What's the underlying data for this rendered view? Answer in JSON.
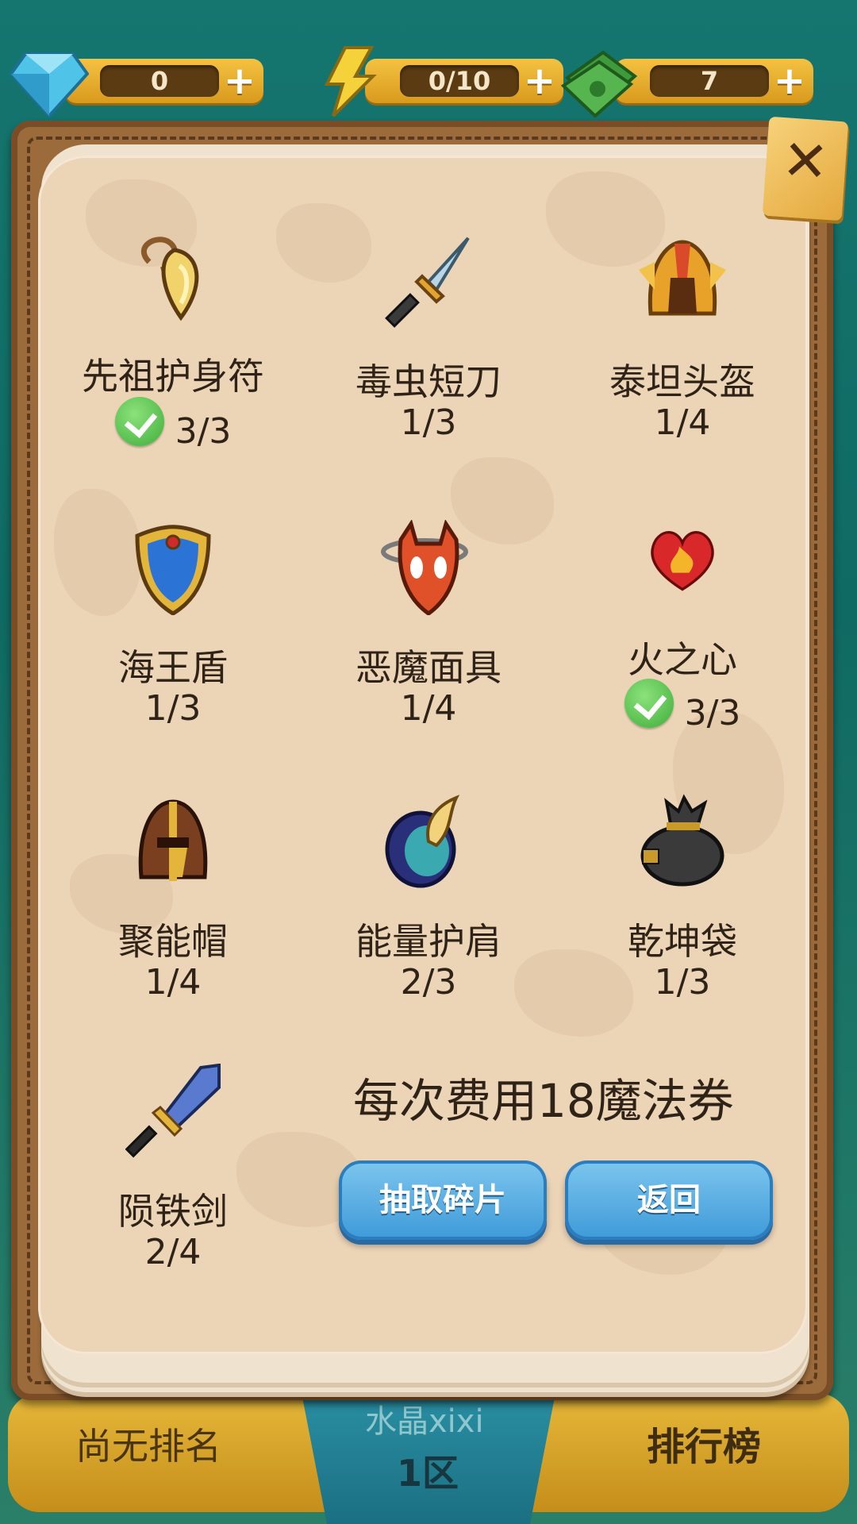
{
  "resources": [
    {
      "name": "diamond",
      "icon": "diamond-icon",
      "value": "0"
    },
    {
      "name": "energy",
      "icon": "lightning-icon",
      "value": "0/10"
    },
    {
      "name": "cash",
      "icon": "cash-icon",
      "value": "7"
    }
  ],
  "items": [
    {
      "name": "先祖护身符",
      "count": "3/3",
      "complete": true,
      "icon": "amulet-icon"
    },
    {
      "name": "毒虫短刀",
      "count": "1/3",
      "complete": false,
      "icon": "dagger-icon"
    },
    {
      "name": "泰坦头盔",
      "count": "1/4",
      "complete": false,
      "icon": "titan-helmet-icon"
    },
    {
      "name": "海王盾",
      "count": "1/3",
      "complete": false,
      "icon": "shield-icon"
    },
    {
      "name": "恶魔面具",
      "count": "1/4",
      "complete": false,
      "icon": "demon-mask-icon"
    },
    {
      "name": "火之心",
      "count": "3/3",
      "complete": true,
      "icon": "fire-heart-icon"
    },
    {
      "name": "聚能帽",
      "count": "1/4",
      "complete": false,
      "icon": "bronze-helmet-icon"
    },
    {
      "name": "能量护肩",
      "count": "2/3",
      "complete": false,
      "icon": "shoulder-pad-icon"
    },
    {
      "name": "乾坤袋",
      "count": "1/3",
      "complete": false,
      "icon": "bag-icon"
    },
    {
      "name": "陨铁剑",
      "count": "2/4",
      "complete": false,
      "icon": "meteor-sword-icon"
    }
  ],
  "cost_text": "每次费用18魔法券",
  "buttons": {
    "draw": "抽取碎片",
    "back": "返回"
  },
  "bottom": {
    "rank": "尚无排名",
    "server": "水晶xixi",
    "zone": "1区",
    "leaderboard": "排行榜"
  },
  "colors": {
    "accent_gold": "#e4a83c",
    "button_blue": "#3e9ad8",
    "check_green": "#3fae3a",
    "page": "#ecd4b7"
  }
}
